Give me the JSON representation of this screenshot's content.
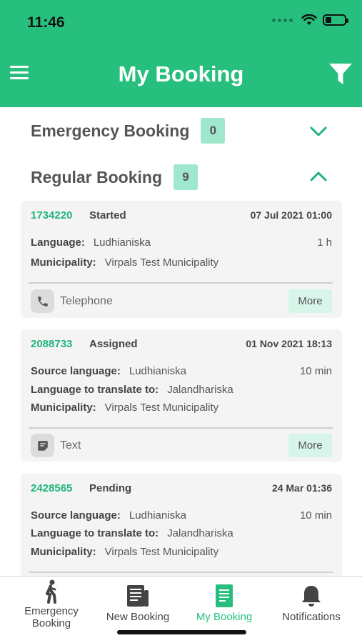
{
  "status_bar": {
    "time": "11:46"
  },
  "header": {
    "title": "My Booking",
    "menu_icon": "hamburger-menu-icon",
    "filter_icon": "filter-icon"
  },
  "colors": {
    "brand": "#26bf7d",
    "badge": "#9fe8cd",
    "more_button": "#d7f5e9",
    "card": "#f4f4f4"
  },
  "sections": {
    "emergency": {
      "title": "Emergency Booking",
      "count": "0",
      "state": "collapsed"
    },
    "regular": {
      "title": "Regular Booking",
      "count": "9",
      "state": "expanded"
    }
  },
  "bookings": [
    {
      "id": "1734220",
      "status": "Started",
      "date": "07 Jul 2021 01:00",
      "language_label": "Language:",
      "language": "Ludhianiska",
      "duration": "1 h",
      "municipality_label": "Municipality:",
      "municipality": "Virpals Test Municipality",
      "type": "Telephone",
      "type_icon": "phone-icon",
      "more": "More"
    },
    {
      "id": "2088733",
      "status": "Assigned",
      "date": "01 Nov 2021 18:13",
      "source_label": "Source language:",
      "source": "Ludhianiska",
      "duration": "10 min",
      "target_label": "Language to translate to:",
      "target": "Jalandhariska",
      "municipality_label": "Municipality:",
      "municipality": "Virpals Test Municipality",
      "type": "Text",
      "type_icon": "note-icon",
      "more": "More"
    },
    {
      "id": "2428565",
      "status": "Pending",
      "date": "24 Mar 01:36",
      "source_label": "Source language:",
      "source": "Ludhianiska",
      "duration": "10 min",
      "target_label": "Language to translate to:",
      "target": "Jalandhariska",
      "municipality_label": "Municipality:",
      "municipality": "Virpals Test Municipality"
    }
  ],
  "tabbar": {
    "emergency": {
      "line1": "Emergency",
      "line2": "Booking"
    },
    "new": "New Booking",
    "mine": "My Booking",
    "notifications": "Notifications",
    "active": "My Booking"
  }
}
